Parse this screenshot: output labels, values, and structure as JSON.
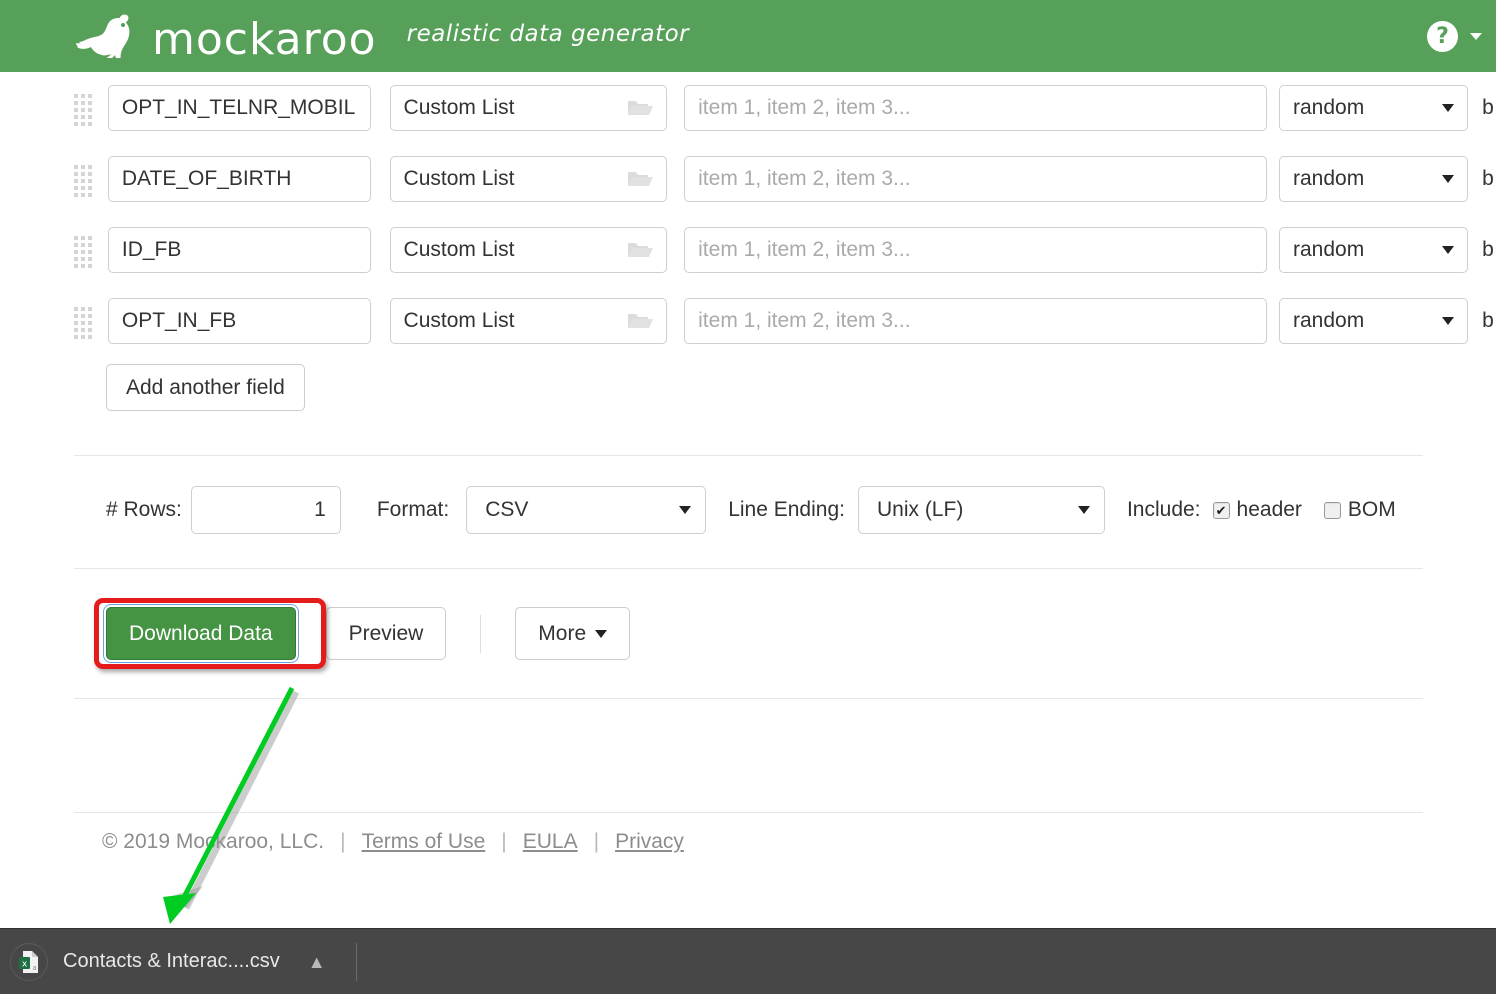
{
  "header": {
    "logo_text": "mockaroo",
    "tagline": "realistic data generator",
    "help_icon": "question-mark-icon",
    "caret_icon": "chevron-down-icon"
  },
  "fields": {
    "rows": [
      {
        "name": "OPT_IN_TELNR_MOBIL",
        "type": "Custom List",
        "values_placeholder": "item 1, item 2, item 3...",
        "distribution": "random",
        "blank_label": "b"
      },
      {
        "name": "DATE_OF_BIRTH",
        "type": "Custom List",
        "values_placeholder": "item 1, item 2, item 3...",
        "distribution": "random",
        "blank_label": "b"
      },
      {
        "name": "ID_FB",
        "type": "Custom List",
        "values_placeholder": "item 1, item 2, item 3...",
        "distribution": "random",
        "blank_label": "b"
      },
      {
        "name": "OPT_IN_FB",
        "type": "Custom List",
        "values_placeholder": "item 1, item 2, item 3...",
        "distribution": "random",
        "blank_label": "b"
      }
    ],
    "add_field_label": "Add another field"
  },
  "options": {
    "rows_label": "# Rows:",
    "rows_value": "1",
    "format_label": "Format:",
    "format_value": "CSV",
    "line_ending_label": "Line Ending:",
    "line_ending_value": "Unix (LF)",
    "include_label": "Include:",
    "header_label": "header",
    "header_checked": true,
    "bom_label": "BOM",
    "bom_checked": false
  },
  "actions": {
    "download_label": "Download Data",
    "preview_label": "Preview",
    "more_label": "More"
  },
  "footer": {
    "copyright": "© 2019 Mockaroo, LLC.",
    "sep": "|",
    "terms_label": "Terms of Use",
    "eula_label": "EULA",
    "privacy_label": "Privacy"
  },
  "download_bar": {
    "file_name": "Contacts & Interac....csv",
    "file_icon": "csv-file-icon",
    "chevron_icon": "chevron-up-icon"
  },
  "annotations": {
    "highlight_color": "#e51b1b",
    "arrow_color": "#00cc22"
  }
}
